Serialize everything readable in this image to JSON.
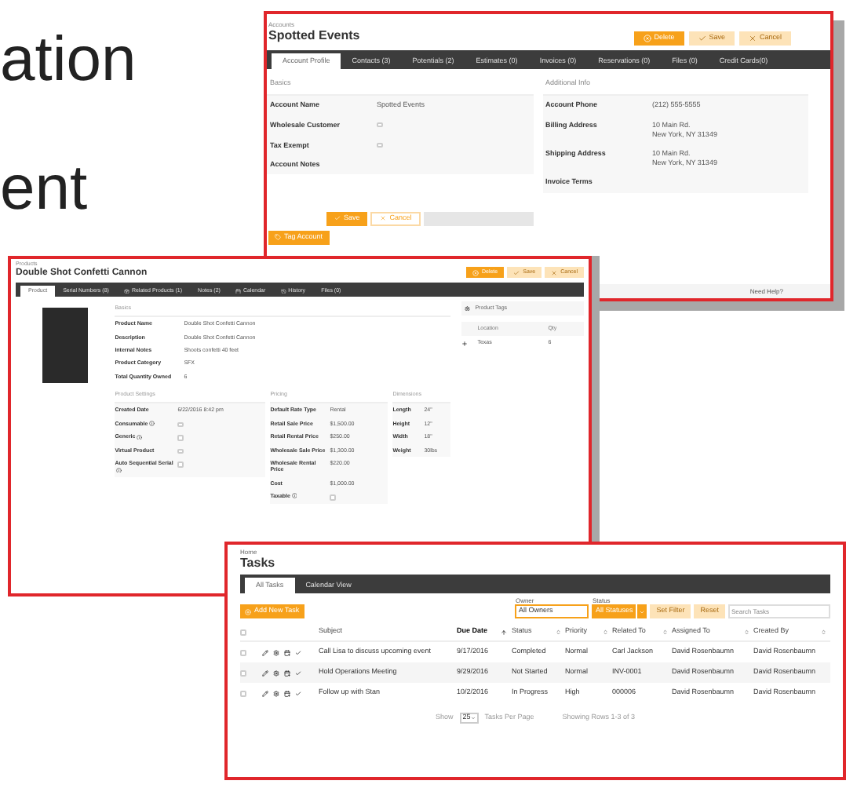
{
  "headline": [
    "ation",
    "ent"
  ],
  "accounts": {
    "breadcrumb": "Accounts",
    "title": "Spotted Events",
    "actions": [
      {
        "label": "Delete",
        "kind": "delete",
        "disabled": false
      },
      {
        "label": "Save",
        "kind": "save",
        "disabled": true
      },
      {
        "label": "Cancel",
        "kind": "cancel",
        "disabled": true
      }
    ],
    "tabs": [
      {
        "label": "Account Profile",
        "selected": true
      },
      {
        "label": "Contacts (3)",
        "selected": false
      },
      {
        "label": "Potentials (2)",
        "selected": false
      },
      {
        "label": "Estimates (0)",
        "selected": false
      },
      {
        "label": "Invoices (0)",
        "selected": false
      },
      {
        "label": "Reservations (0)",
        "selected": false
      },
      {
        "label": "Files (0)",
        "selected": false
      },
      {
        "label": "Credit Cards(0)",
        "selected": false
      }
    ],
    "sections": [
      {
        "title": "Basics",
        "fields": [
          {
            "label": "Account Name",
            "kind": "text",
            "lines": [
              "Spotted Events"
            ]
          },
          {
            "label": "Wholesale Customer",
            "kind": "check",
            "checked": false
          },
          {
            "label": "Tax Exempt",
            "kind": "check",
            "checked": false
          },
          {
            "label": "Account Notes",
            "kind": "text"
          }
        ]
      },
      {
        "title": "Additional Info",
        "fields": [
          {
            "label": "Account Phone",
            "kind": "text",
            "lines": [
              "(212) 555-5555"
            ]
          },
          {
            "label": "Billing Address",
            "kind": "text",
            "lines": [
              "10 Main Rd.",
              "New York, NY 31349"
            ]
          },
          {
            "label": "Shipping Address",
            "kind": "text",
            "lines": [
              "10 Main Rd.",
              "New York, NY 31349"
            ]
          },
          {
            "label": "Invoice Terms",
            "kind": "text"
          }
        ]
      }
    ],
    "form_buttons": [
      {
        "label": "Save",
        "kind": "save"
      },
      {
        "label": "Cancel",
        "kind": "cancel"
      }
    ],
    "tag_button": "Tag Account",
    "help": "Need Help?"
  },
  "product": {
    "breadcrumb": "Products",
    "title": "Double Shot Confetti Cannon",
    "actions": [
      {
        "label": "Delete",
        "kind": "delete",
        "disabled": false
      },
      {
        "label": "Save",
        "kind": "save",
        "disabled": true
      },
      {
        "label": "Cancel",
        "kind": "cancel",
        "disabled": true
      }
    ],
    "tabs": [
      {
        "label": "Product",
        "selected": true
      },
      {
        "label": "Serial Numbers (8)",
        "selected": false
      },
      {
        "label": "Related Products (1)",
        "selected": false
      },
      {
        "label": "Notes (2)",
        "selected": false
      },
      {
        "label": "Calendar",
        "selected": false
      },
      {
        "label": "History",
        "selected": false
      },
      {
        "label": "Files (0)",
        "selected": false
      }
    ],
    "basics": {
      "title": "Basics",
      "fields": [
        {
          "label": "Product Name",
          "kind": "text",
          "lines": [
            "Double Shot Confetti Cannon"
          ]
        },
        {
          "label": "Description",
          "kind": "text",
          "lines": [
            "Double Shot Confetti Cannon"
          ]
        },
        {
          "label": "Internal Notes",
          "kind": "text",
          "lines": [
            "Shoots confetti 40 feet"
          ]
        },
        {
          "label": "Product Category",
          "kind": "text",
          "lines": [
            "SFX"
          ]
        },
        {
          "label": "Total Quantity Owned",
          "kind": "text",
          "lines": [
            "6"
          ]
        }
      ]
    },
    "columns": [
      {
        "title": "Product Settings",
        "fields": [
          {
            "label": "Created Date",
            "kind": "text",
            "lines": [
              "6/22/2016 8:42 pm"
            ]
          },
          {
            "label": "Consumable",
            "kind": "check",
            "info": true,
            "checked": false
          },
          {
            "label": "Generic",
            "kind": "check",
            "info": true,
            "checked": false
          },
          {
            "label": "Virtual Product",
            "kind": "check",
            "checked": false
          },
          {
            "label": "Auto Sequential Serial",
            "kind": "check",
            "info": true,
            "checked": false
          }
        ]
      },
      {
        "title": "Pricing",
        "fields": [
          {
            "label": "Default Rate Type",
            "kind": "text",
            "lines": [
              "Rental"
            ]
          },
          {
            "label": "Retail Sale Price",
            "kind": "text",
            "lines": [
              "$1,500.00"
            ]
          },
          {
            "label": "Retail Rental Price",
            "kind": "text",
            "lines": [
              "$250.00"
            ]
          },
          {
            "label": "Wholesale Sale Price",
            "kind": "text",
            "lines": [
              "$1,300.00"
            ]
          },
          {
            "label": "Wholesale Rental Price",
            "kind": "text",
            "lines": [
              "$220.00"
            ]
          },
          {
            "label": "Cost",
            "kind": "text",
            "lines": [
              "$1,000.00"
            ]
          },
          {
            "label": "Taxable",
            "kind": "check",
            "info": true,
            "checked": false
          }
        ]
      },
      {
        "title": "Dimensions",
        "fields": [
          {
            "label": "Length",
            "kind": "text",
            "lines": [
              "24\""
            ]
          },
          {
            "label": "Height",
            "kind": "text",
            "lines": [
              "12\""
            ]
          },
          {
            "label": "Width",
            "kind": "text",
            "lines": [
              "18\""
            ]
          },
          {
            "label": "Weight",
            "kind": "text",
            "lines": [
              "30lbs"
            ]
          }
        ]
      }
    ],
    "tags_title": "Product Tags",
    "stock": {
      "columns": [
        "Location",
        "Qty"
      ],
      "rows": [
        {
          "cells": [
            "Texas",
            "6"
          ],
          "expanded": false
        }
      ]
    }
  },
  "tasks": {
    "breadcrumb": "Home",
    "title": "Tasks",
    "tabs": [
      {
        "label": "All Tasks",
        "selected": true
      },
      {
        "label": "Calendar View",
        "selected": false
      }
    ],
    "add_button": "Add New Task",
    "filters": [
      {
        "label": "Owner",
        "value": "All Owners",
        "kind": "input"
      },
      {
        "label": "Status",
        "value": "All Statuses",
        "kind": "select"
      }
    ],
    "filter_buttons": [
      {
        "label": "Set Filter",
        "disabled": true
      },
      {
        "label": "Reset",
        "disabled": true
      }
    ],
    "search": {
      "placeholder": "Search Tasks"
    },
    "select_all_checked": false,
    "columns": [
      {
        "label": "Subject",
        "sortable": false,
        "sorted": false
      },
      {
        "label": "Due Date",
        "sortable": true,
        "sorted": true
      },
      {
        "label": "Status",
        "sortable": true,
        "sorted": false
      },
      {
        "label": "Priority",
        "sortable": true,
        "sorted": false
      },
      {
        "label": "Related To",
        "sortable": true,
        "sorted": false
      },
      {
        "label": "Assigned To",
        "sortable": true,
        "sorted": false
      },
      {
        "label": "Created By",
        "sortable": true,
        "sorted": false
      }
    ],
    "rows": [
      {
        "checked": false,
        "cells": [
          "Call Lisa to discuss upcoming event",
          "9/17/2016",
          "Completed",
          "Normal",
          "Carl Jackson",
          "David Rosenbaumn",
          "David Rosenbaumn"
        ]
      },
      {
        "checked": false,
        "cells": [
          "Hold Operations Meeting",
          "9/29/2016",
          "Not Started",
          "Normal",
          "INV-0001",
          "David Rosenbaumn",
          "David Rosenbaumn"
        ]
      },
      {
        "checked": false,
        "cells": [
          "Follow up with Stan",
          "10/2/2016",
          "In Progress",
          "High",
          "000006",
          "David Rosenbaumn",
          "David Rosenbaumn"
        ]
      }
    ],
    "footer": {
      "show": "Show",
      "per_page": "25",
      "per_page_label": "Tasks Per Page",
      "summary": "Showing Rows 1-3 of 3"
    }
  }
}
